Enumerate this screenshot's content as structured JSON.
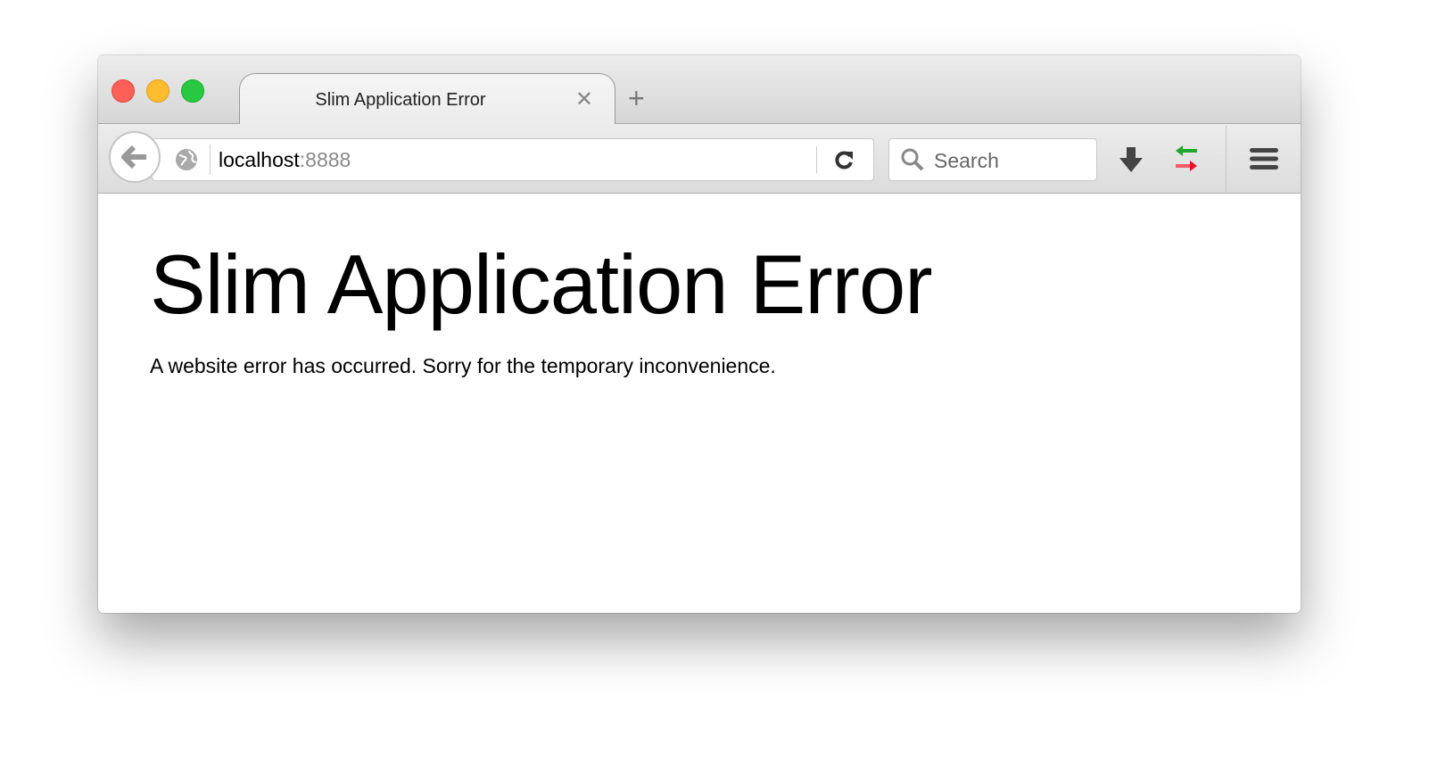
{
  "window": {
    "traffic_lights": {
      "close": "#fe5f57",
      "minimize": "#febc2e",
      "zoom": "#28c840"
    }
  },
  "tab": {
    "title": "Slim Application Error",
    "close_icon": "close-icon",
    "new_tab_icon": "plus-icon"
  },
  "toolbar": {
    "url_host": "localhost",
    "url_port": ":8888",
    "search_placeholder": "Search",
    "icons": [
      "back-arrow-icon",
      "globe-icon",
      "reload-icon",
      "search-icon",
      "download-icon",
      "sync-arrows-icon",
      "hamburger-menu-icon"
    ]
  },
  "page": {
    "heading": "Slim Application Error",
    "message": "A website error has occurred. Sorry for the temporary inconvenience."
  }
}
